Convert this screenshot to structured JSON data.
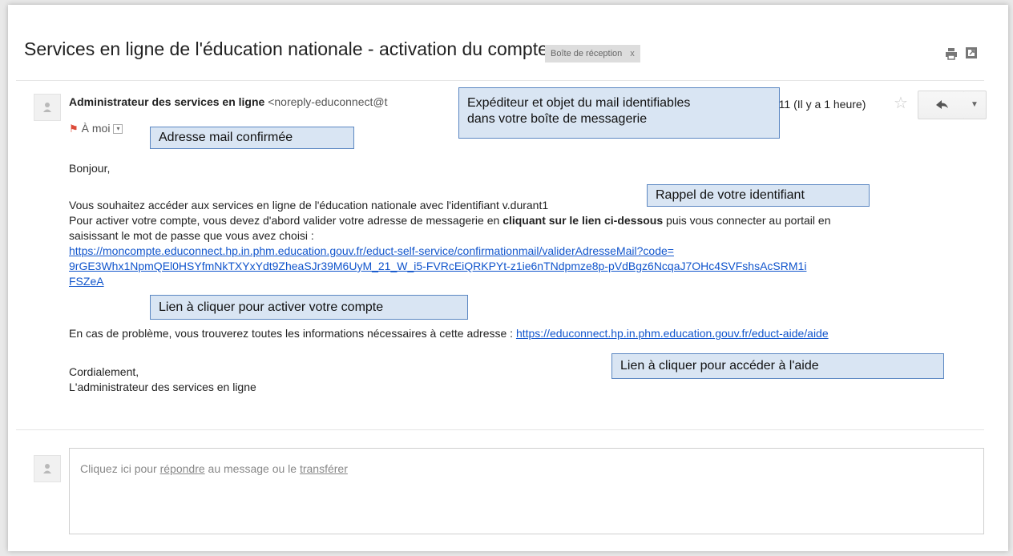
{
  "email": {
    "subject": "Services en ligne de l'éducation nationale - activation du compte",
    "label_chip": "Boîte de réception",
    "label_close": "x",
    "sender_name": "Administrateur des services en ligne",
    "sender_address": "<noreply-educonnect@t",
    "time": "2:11 (Il y a 1 heure)",
    "recipient": "À moi",
    "greeting": "Bonjour,",
    "line1": "Vous souhaitez accéder aux services en ligne de l'éducation nationale avec l'identifiant v.durant1",
    "line2_pre": "Pour activer votre compte, vous devez d'abord valider votre adresse de messagerie en ",
    "line2_bold": "cliquant sur le lien ci-dessous",
    "line2_post": " puis vous connecter au portail en",
    "line3": "saisissant le mot de passe que vous avez choisi :",
    "activation_link_1": "https://moncompte.educonnect.hp.in.phm.education.gouv.fr/educt-self-service/confirmationmail/validerAdresseMail?code=",
    "activation_link_2": "9rGE3Whx1NpmQEl0HSYfmNkTXYxYdt9ZheaSJr39M6UyM_21_W_i5-FVRcEiQRKPYt-z1ie6nTNdpmze8p-pVdBgz6NcqaJ7OHc4SVFshsAcSRM1i",
    "activation_link_3": "FSZeA",
    "help_text": "En cas de problème, vous trouverez toutes les informations nécessaires à cette adresse : ",
    "help_link": "https://educonnect.hp.in.phm.education.gouv.fr/educt-aide/aide",
    "closing": "Cordialement,",
    "signature": "L'administrateur des services en ligne"
  },
  "reply_box": {
    "pre": "Cliquez ici pour ",
    "reply_link": "répondre",
    "mid": " au message ou le ",
    "forward_link": "transférer"
  },
  "callouts": {
    "sender_subject_1": "Expéditeur  et objet du mail  identifiables",
    "sender_subject_2": "dans votre boîte de messagerie",
    "email_confirmed": "Adresse mail confirmée",
    "identifier_reminder": "Rappel de votre identifiant",
    "activate_link": "Lien à cliquer pour activer votre compte",
    "help_link": "Lien à cliquer pour accéder à l'aide"
  },
  "icons": {
    "print": "printer-icon",
    "popout": "new-window-icon",
    "avatar": "person-icon",
    "star": "star-icon",
    "reply": "reply-arrow-icon",
    "more": "chevron-down-icon",
    "important": "important-marker-icon"
  },
  "colors": {
    "link": "#1155cc",
    "callout_bg": "#d9e5f3",
    "callout_border": "#5b87c2",
    "important": "#dd4b39"
  }
}
